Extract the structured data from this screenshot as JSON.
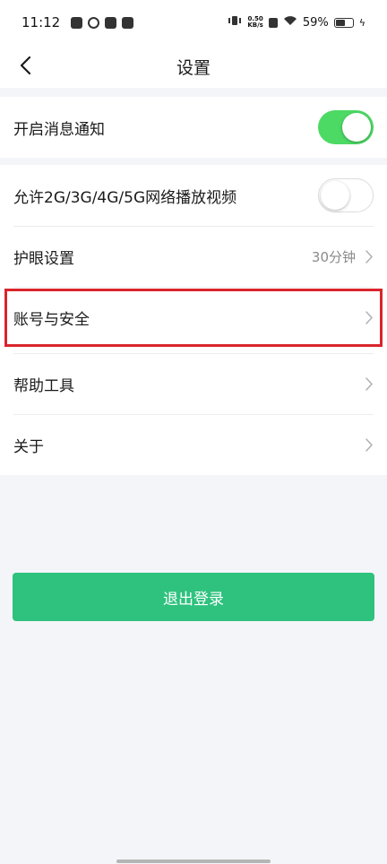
{
  "status_bar": {
    "time": "11:12",
    "speed_value": "0.50",
    "speed_unit": "KB/s",
    "battery": "59%",
    "battery_level": 0.59,
    "icons": [
      "gallery-icon",
      "link-icon",
      "tiktok-icon",
      "mail-icon",
      "vibrate-icon",
      "close-box-icon",
      "wifi-icon",
      "battery-icon",
      "charging-icon"
    ]
  },
  "header": {
    "title": "设置",
    "back_icon": "chevron-left-icon"
  },
  "groups": [
    {
      "items": [
        {
          "label": "开启消息通知",
          "control": "toggle",
          "state": "on"
        }
      ]
    },
    {
      "items": [
        {
          "label": "允许2G/3G/4G/5G网络播放视频",
          "control": "toggle",
          "state": "off"
        },
        {
          "label": "护眼设置",
          "value": "30分钟",
          "control": "chevron"
        },
        {
          "label": "账号与安全",
          "control": "chevron"
        },
        {
          "label": "帮助工具",
          "control": "chevron"
        },
        {
          "label": "关于",
          "control": "chevron"
        }
      ]
    }
  ],
  "logout": {
    "label": "退出登录"
  },
  "colors": {
    "toggle_on": "#4cd964",
    "logout_button": "#2ec27e",
    "highlight": "#d9252c",
    "page_background": "#f4f5f9"
  }
}
